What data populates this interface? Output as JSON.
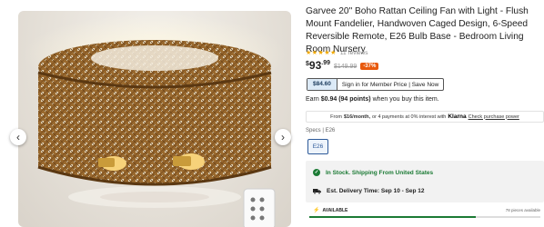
{
  "product": {
    "title": "Garvee 20\" Boho Rattan Ceiling Fan with Light - Flush Mount Fandelier, Handwoven Caged Design, 6-Speed Reversible Remote, E26 Bulb Base - Bedroom Living Room Nursery",
    "stars": "★★★★★",
    "reviews": "11 reviews"
  },
  "gallery": {
    "prev_icon": "‹",
    "next_icon": "›"
  },
  "price": {
    "currency": "$",
    "dollars": "93",
    "cents": ".99",
    "old": "$149.99",
    "discount": "-37%"
  },
  "member": {
    "price": "$84.60",
    "text": "Sign in for Member Price | Save Now"
  },
  "points": {
    "prefix": "Earn",
    "bold": "$0.94 (94 points)",
    "suffix": "when you buy this item."
  },
  "klarna": {
    "text_before": "From",
    "amount": "$16/month,",
    "text_mid": "or 4 payments at 0% interest with",
    "brand": "Klarna",
    "link": "Check purchase power"
  },
  "specs": {
    "label": "Specs | E26",
    "options": [
      "E26"
    ]
  },
  "stock": {
    "in_stock": "In Stock. Shipping From United States",
    "delivery": "Est. Delivery Time: Sep 10 - Sep 12"
  },
  "availability": {
    "label": "AVAILABLE",
    "count": "78 pieces available",
    "fill_fraction": 0.72
  },
  "colors": {
    "accent_blue": "#2e5a99",
    "discount_orange": "#e8590c",
    "stock_green": "#1b7a34",
    "star_gold": "#f2a900"
  }
}
